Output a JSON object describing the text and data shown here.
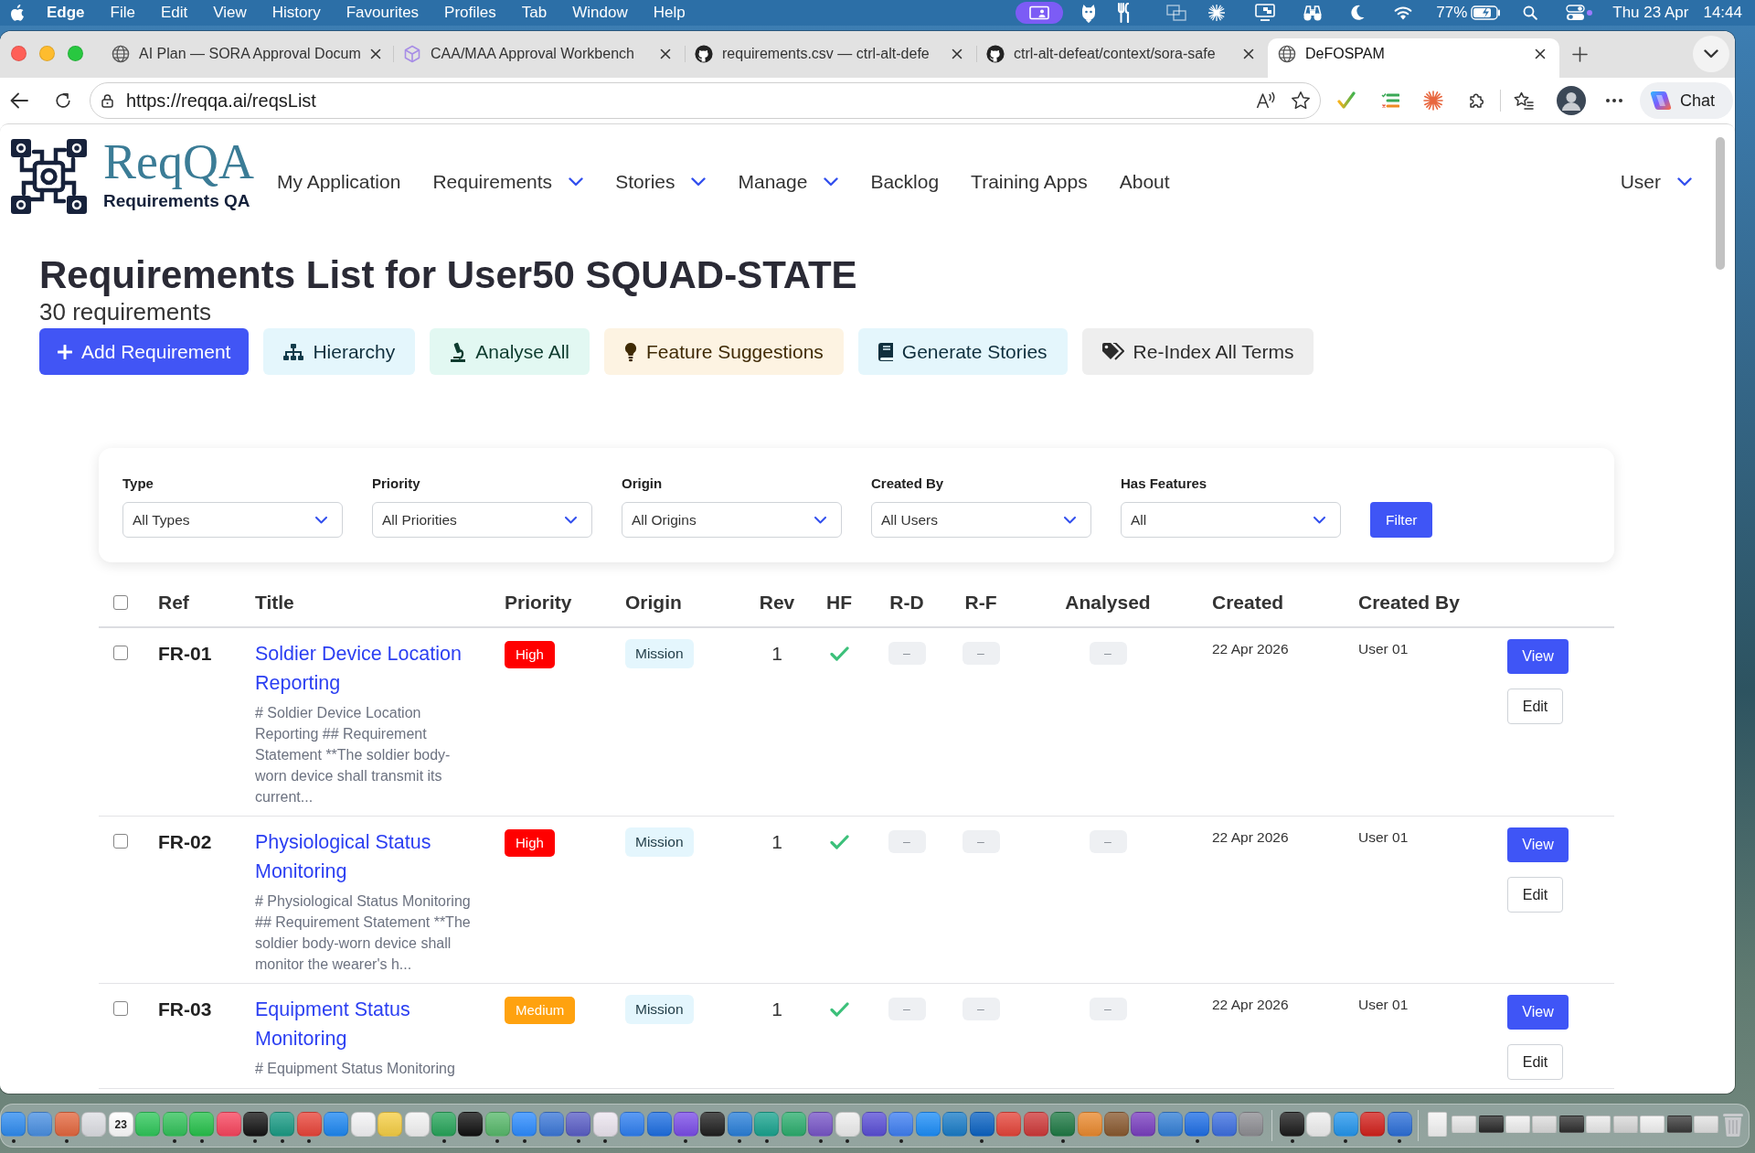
{
  "menu_bar": {
    "app": "Edge",
    "menus": [
      "File",
      "Edit",
      "View",
      "History",
      "Favourites",
      "Profiles",
      "Tab",
      "Window",
      "Help"
    ],
    "battery": "77%",
    "date": "Thu 23 Apr",
    "time": "14:44"
  },
  "browser": {
    "tabs": [
      {
        "title": "AI Plan — SORA Approval Docum",
        "selected": false
      },
      {
        "title": "CAA/MAA Approval Workbench",
        "selected": false
      },
      {
        "title": "requirements.csv — ctrl-alt-defe",
        "selected": false
      },
      {
        "title": "ctrl-alt-defeat/context/sora-safe",
        "selected": false
      },
      {
        "title": "DeFOSPAM",
        "selected": true
      }
    ],
    "url": "https://reqqa.ai/reqsList",
    "chat": "Chat"
  },
  "app": {
    "brand": "ReqQA",
    "tagline": "Requirements QA",
    "nav": [
      {
        "label": "My Application",
        "dropdown": false
      },
      {
        "label": "Requirements",
        "dropdown": true
      },
      {
        "label": "Stories",
        "dropdown": true
      },
      {
        "label": "Manage",
        "dropdown": true
      },
      {
        "label": "Backlog",
        "dropdown": false
      },
      {
        "label": "Training Apps",
        "dropdown": false
      },
      {
        "label": "About",
        "dropdown": false
      }
    ],
    "user_menu": {
      "label": "User",
      "dropdown": true
    }
  },
  "page": {
    "title": "Requirements List for User50 SQUAD-STATE",
    "count": "30 requirements",
    "actions": [
      {
        "label": "Add Requirement",
        "kind": "primary"
      },
      {
        "label": "Hierarchy",
        "kind": "info"
      },
      {
        "label": "Analyse All",
        "kind": "success"
      },
      {
        "label": "Feature Suggestions",
        "kind": "warning"
      },
      {
        "label": "Generate Stories",
        "kind": "info"
      },
      {
        "label": "Re-Index All Terms",
        "kind": "secondary"
      }
    ]
  },
  "filters": {
    "fields": [
      {
        "label": "Type",
        "value": "All Types"
      },
      {
        "label": "Priority",
        "value": "All Priorities"
      },
      {
        "label": "Origin",
        "value": "All Origins"
      },
      {
        "label": "Created By",
        "value": "All Users"
      },
      {
        "label": "Has Features",
        "value": "All"
      }
    ],
    "button": "Filter"
  },
  "table": {
    "select_all": {
      "checked": false
    },
    "columns": [
      "Ref",
      "Title",
      "Priority",
      "Origin",
      "Rev",
      "HF",
      "R-D",
      "R-F",
      "Analysed",
      "Created",
      "Created By"
    ],
    "rows": [
      {
        "checked": false,
        "ref": "FR-01",
        "title": "Soldier Device Location Reporting",
        "description": "# Soldier Device Location Reporting ## Requirement Statement **The soldier body-worn device shall transmit its current...",
        "priority": {
          "label": "High",
          "color": "#ff0000"
        },
        "origin": "Mission",
        "rev": "1",
        "hf": true,
        "r_d": "–",
        "r_f": "–",
        "analysed": "–",
        "created": "22 Apr 2026",
        "created_by": "User 01",
        "actions": [
          "View",
          "Edit"
        ]
      },
      {
        "checked": false,
        "ref": "FR-02",
        "title": "Physiological Status Monitoring",
        "description": "# Physiological Status Monitoring ## Requirement Statement **The soldier body-worn device shall monitor the wearer's h...",
        "priority": {
          "label": "High",
          "color": "#ff0000"
        },
        "origin": "Mission",
        "rev": "1",
        "hf": true,
        "r_d": "–",
        "r_f": "–",
        "analysed": "–",
        "created": "22 Apr 2026",
        "created_by": "User 01",
        "actions": [
          "View",
          "Edit"
        ]
      },
      {
        "checked": false,
        "ref": "FR-03",
        "title": "Equipment Status Monitoring",
        "description": "# Equipment Status Monitoring",
        "priority": {
          "label": "Medium",
          "color": "#ffa20f"
        },
        "origin": "Mission",
        "rev": "1",
        "hf": true,
        "r_d": "–",
        "r_f": "–",
        "analysed": "–",
        "created": "22 Apr 2026",
        "created_by": "User 01",
        "actions": [
          "View",
          "Edit"
        ]
      }
    ]
  },
  "dock": {
    "apps": [
      {
        "color": "#2f8cf0",
        "running": true
      },
      {
        "color": "#4a90e2",
        "running": false
      },
      {
        "color": "#e4683f",
        "running": true
      },
      {
        "color": "#dedfe4",
        "running": false
      },
      {
        "color": "#ffffff",
        "running": false,
        "label": "23"
      },
      {
        "color": "#2fc75a",
        "running": false
      },
      {
        "color": "#32c25a",
        "running": true
      },
      {
        "color": "#27c24c",
        "running": true
      },
      {
        "color": "#f8455e",
        "running": false
      },
      {
        "color": "#151515",
        "running": true
      },
      {
        "color": "#1b9c85",
        "running": true
      },
      {
        "color": "#e9453a",
        "running": true
      },
      {
        "color": "#1e88f2",
        "running": false
      },
      {
        "color": "#f4f4f6",
        "running": false
      },
      {
        "color": "#f6cf45",
        "running": false
      },
      {
        "color": "#f3f3f3",
        "running": false
      },
      {
        "color": "#27a55a",
        "running": true
      },
      {
        "color": "#111111",
        "running": false
      },
      {
        "color": "#58b96b",
        "running": true
      },
      {
        "color": "#2d8cff",
        "running": true
      },
      {
        "color": "#3c78d8",
        "running": false
      },
      {
        "color": "#5b5fc7",
        "running": true
      },
      {
        "color": "#ece6f0",
        "running": true
      },
      {
        "color": "#2f7ff0",
        "running": false
      },
      {
        "color": "#1e6fe2",
        "running": false
      },
      {
        "color": "#7b4de8",
        "running": true
      },
      {
        "color": "#202020",
        "running": false
      },
      {
        "color": "#2a80d9",
        "running": true
      },
      {
        "color": "#1aa48f",
        "running": true
      },
      {
        "color": "#2cae6e",
        "running": false
      },
      {
        "color": "#7856c8",
        "running": true
      },
      {
        "color": "#eeeeee",
        "running": true
      },
      {
        "color": "#5a4fd6",
        "running": false
      },
      {
        "color": "#3f7ff2",
        "running": true
      },
      {
        "color": "#1d8ef8",
        "running": false
      },
      {
        "color": "#1a7dc8",
        "running": false
      },
      {
        "color": "#0b63c3",
        "running": true
      },
      {
        "color": "#e5453a",
        "running": false
      },
      {
        "color": "#cf3a3a",
        "running": false
      },
      {
        "color": "#1f7a45",
        "running": true
      },
      {
        "color": "#ea8a2f",
        "running": false
      },
      {
        "color": "#8a5a30",
        "running": false
      },
      {
        "color": "#7a3fc0",
        "running": false
      },
      {
        "color": "#3480d6",
        "running": false
      },
      {
        "color": "#1f6fe6",
        "running": true
      },
      {
        "color": "#3d6fe0",
        "running": false
      },
      {
        "color": "#8e8e93",
        "running": false
      }
    ],
    "utilities": [
      {
        "color": "#1c1c1c",
        "running": true
      },
      {
        "color": "#efefef",
        "running": false
      },
      {
        "color": "#2496ed",
        "running": true
      },
      {
        "color": "#d3221d",
        "running": false
      },
      {
        "color": "#2c6fd8",
        "running": true
      }
    ],
    "recent": [
      {
        "kind": "document",
        "color": "#f4f4f4"
      },
      {
        "kind": "window",
        "color": "#e6e6e6"
      },
      {
        "kind": "window",
        "color": "#2b2b2b"
      },
      {
        "kind": "window",
        "color": "#f0f0f0"
      },
      {
        "kind": "window",
        "color": "#dcdcdc"
      },
      {
        "kind": "window",
        "color": "#303030"
      },
      {
        "kind": "window",
        "color": "#eaeaea"
      },
      {
        "kind": "window",
        "color": "#d8d8d8"
      },
      {
        "kind": "window",
        "color": "#f2f2f2"
      },
      {
        "kind": "window",
        "color": "#3a3a3a"
      },
      {
        "kind": "window",
        "color": "#e2e2e2"
      },
      {
        "kind": "trash",
        "color": "#c9cacd"
      }
    ]
  }
}
